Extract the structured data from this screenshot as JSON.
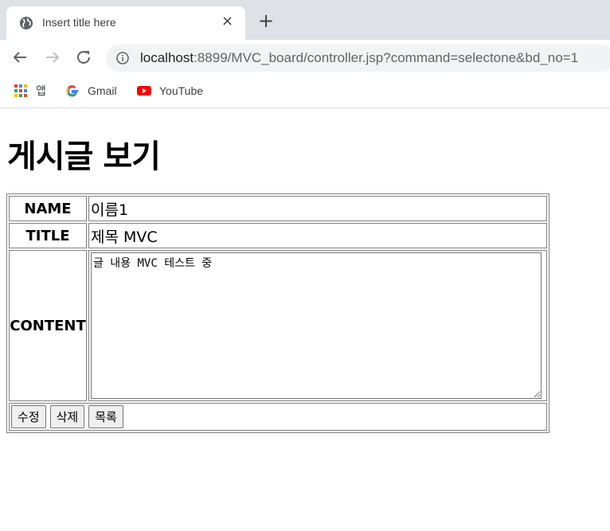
{
  "browser": {
    "tab_title": "Insert title here",
    "close_icon": "×",
    "new_tab_icon": "+",
    "url_host": "localhost",
    "url_rest": ":8899/MVC_board/controller.jsp?command=selectone&bd_no=1",
    "bookmarks": [
      {
        "label": "앱",
        "icon": "apps-grid-icon"
      },
      {
        "label": "Gmail",
        "icon": "google-icon"
      },
      {
        "label": "YouTube",
        "icon": "youtube-icon"
      }
    ]
  },
  "page": {
    "heading": "게시글 보기",
    "rows": {
      "name_label": "NAME",
      "name_value": "이름1",
      "title_label": "TITLE",
      "title_value": "제목 MVC",
      "content_label": "CONTENT",
      "content_value": "글 내용 MVC 테스트 중"
    },
    "buttons": {
      "edit": "수정",
      "delete": "삭제",
      "list": "목록"
    }
  }
}
